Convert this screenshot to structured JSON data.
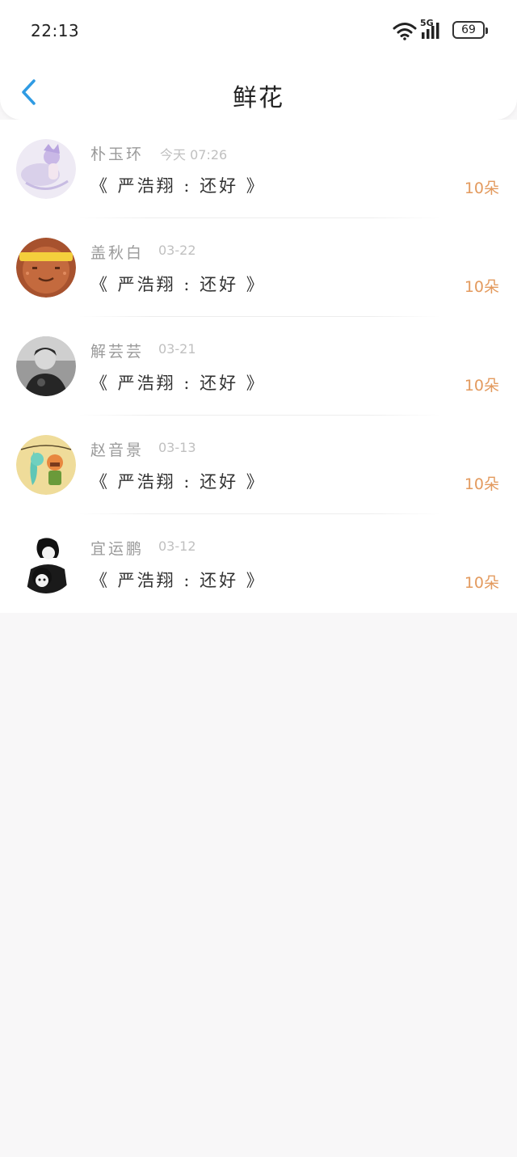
{
  "status_bar": {
    "time": "22:13",
    "network": "5G",
    "battery": "69"
  },
  "header": {
    "title": "鲜花",
    "back_icon": "chevron-left-icon",
    "accent_color": "#2f9be3"
  },
  "gifts": [
    {
      "name": "朴玉环",
      "date": "今天 07:26",
      "message": "《 严浩翔 : 还好 》",
      "count": "10朵"
    },
    {
      "name": "盖秋白",
      "date": "03-22",
      "message": "《 严浩翔 : 还好 》",
      "count": "10朵"
    },
    {
      "name": "解芸芸",
      "date": "03-21",
      "message": "《 严浩翔 : 还好 》",
      "count": "10朵"
    },
    {
      "name": "赵音景",
      "date": "03-13",
      "message": "《 严浩翔 : 还好 》",
      "count": "10朵"
    },
    {
      "name": "宜运鹏",
      "date": "03-12",
      "message": "《 严浩翔 : 还好 》",
      "count": "10朵"
    }
  ],
  "colors": {
    "count": "#e39a5e",
    "background": "#f8f7f8"
  }
}
